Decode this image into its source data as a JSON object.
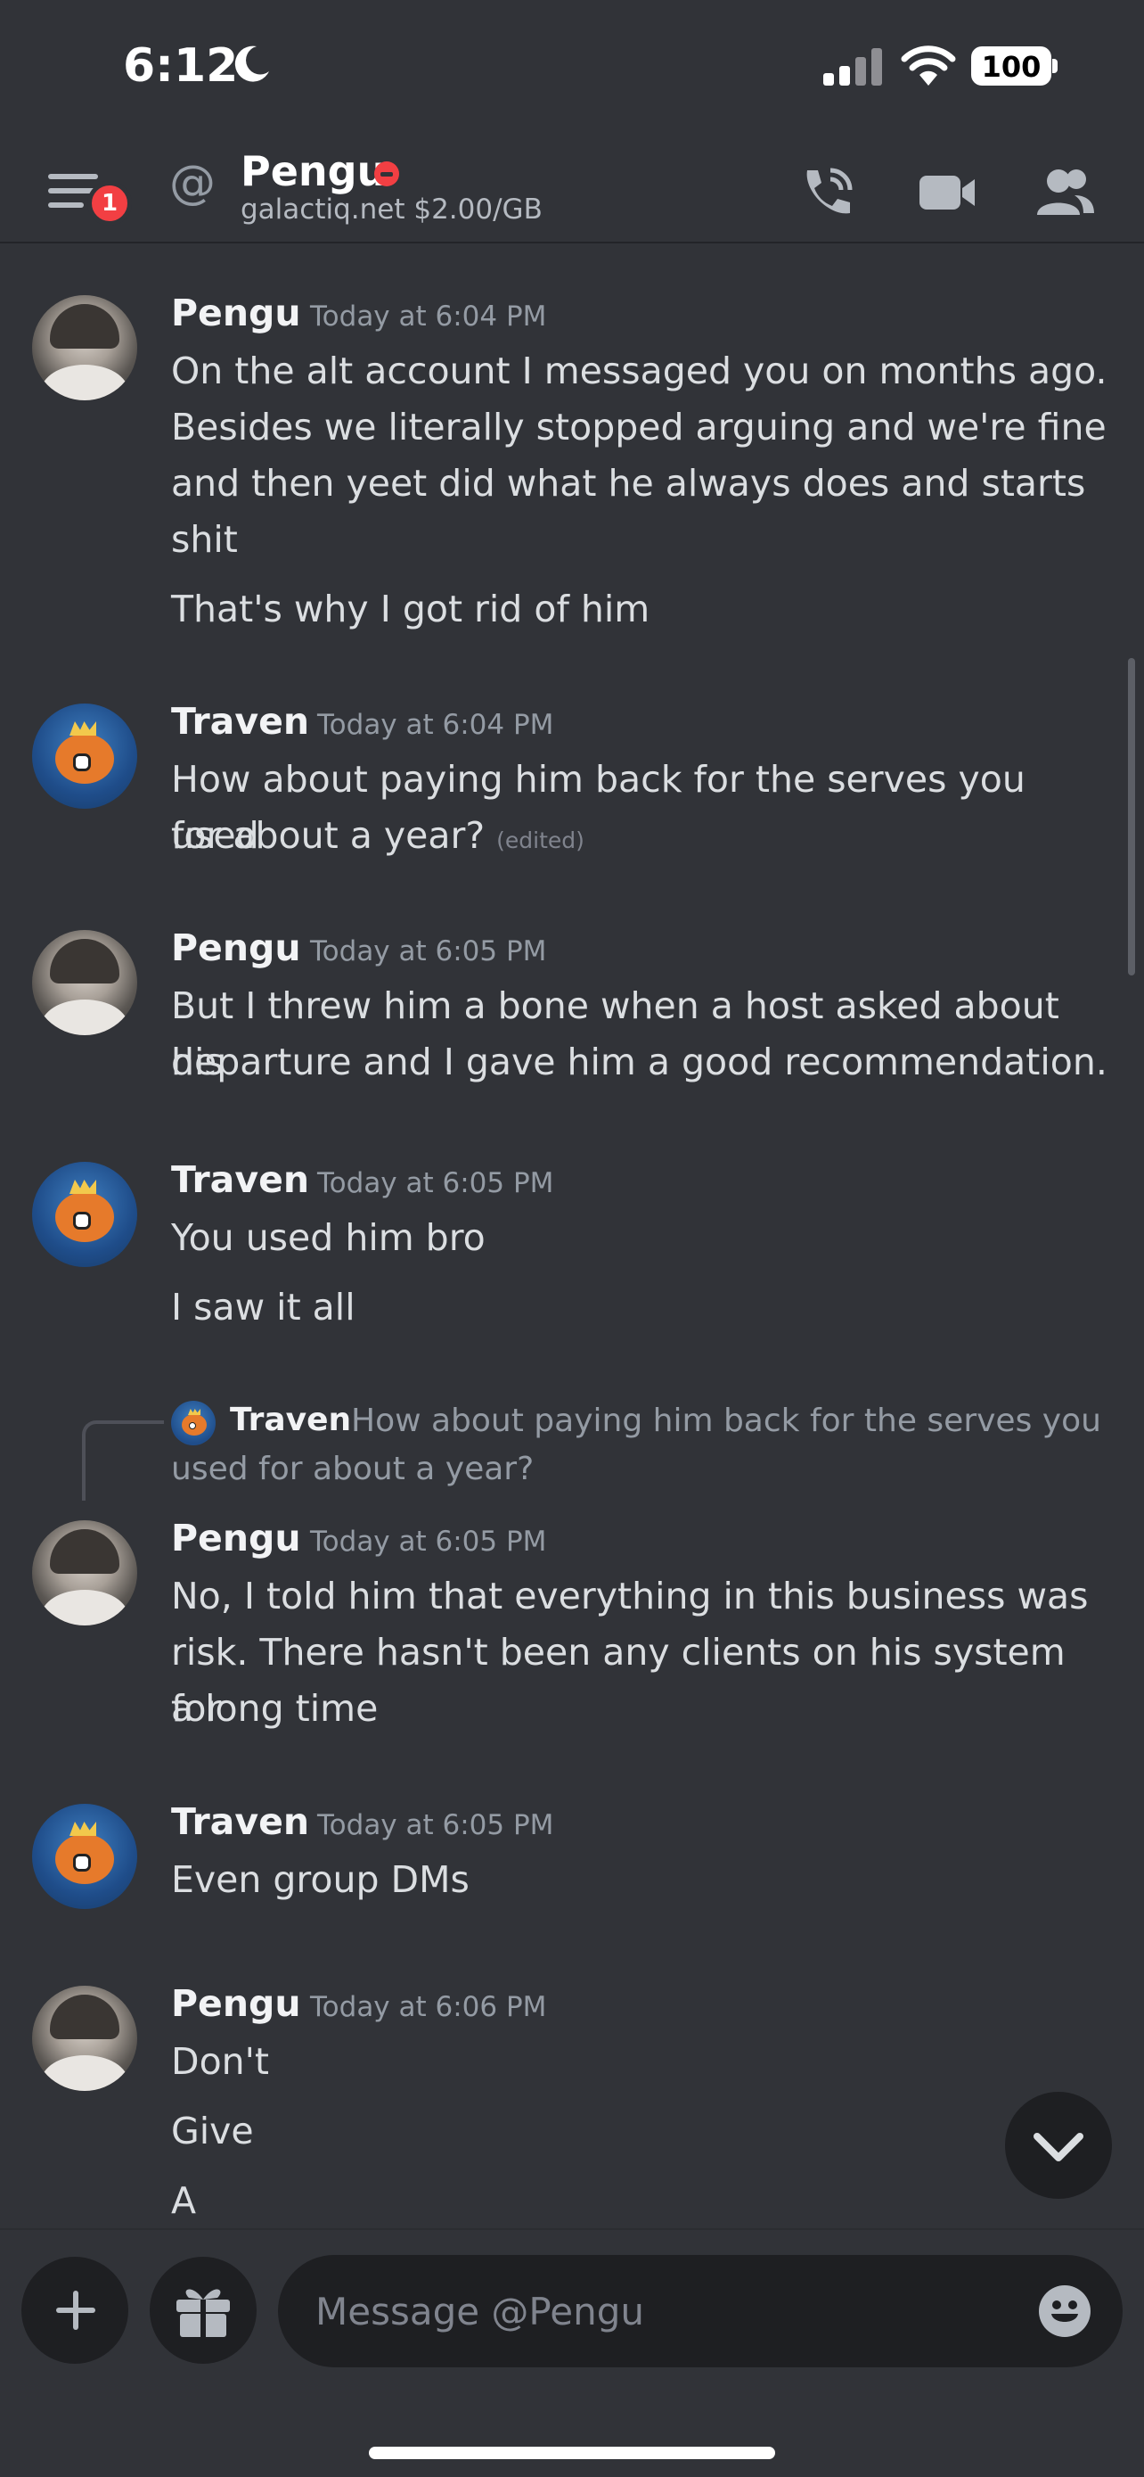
{
  "status_bar": {
    "time": "6:12",
    "battery": "100"
  },
  "header": {
    "at_symbol": "@",
    "name": "Pengu",
    "status": "galactiq.net $2.00/GB",
    "notif_count": "1"
  },
  "messages": [
    {
      "author": "Pengu",
      "timestamp": "Today at 6:04 PM",
      "lines": [
        "On the alt account I messaged you on months ago.",
        "Besides we literally stopped arguing and we're fine",
        "and then yeet did what he always does and starts",
        "shit",
        "That's why I got rid of him"
      ]
    },
    {
      "author": "Traven",
      "timestamp": "Today at 6:04 PM",
      "lines": [
        "How about paying him back for the serves you used",
        "for about a year?"
      ],
      "edited": "(edited)"
    },
    {
      "author": "Pengu",
      "timestamp": "Today at 6:05 PM",
      "lines": [
        "But I threw him a bone when a host asked about his",
        "departure and I gave him a good recommendation."
      ]
    },
    {
      "author": "Traven",
      "timestamp": "Today at 6:05 PM",
      "lines": [
        "You used him bro",
        "I saw it all"
      ]
    },
    {
      "author": "Pengu",
      "timestamp": "Today at 6:05 PM",
      "reply": {
        "author": "Traven",
        "text": "How about paying him back for the serves you used for about a year?"
      },
      "lines": [
        "No, I told him that everything in this business was",
        "risk. There hasn't been any clients on his system for",
        "a long time"
      ]
    },
    {
      "author": "Traven",
      "timestamp": "Today at 6:05 PM",
      "lines": [
        "Even group DMs"
      ]
    },
    {
      "author": "Pengu",
      "timestamp": "Today at 6:06 PM",
      "lines": [
        "Don't",
        "Give",
        "A"
      ]
    }
  ],
  "composer": {
    "placeholder": "Message @Pengu"
  }
}
